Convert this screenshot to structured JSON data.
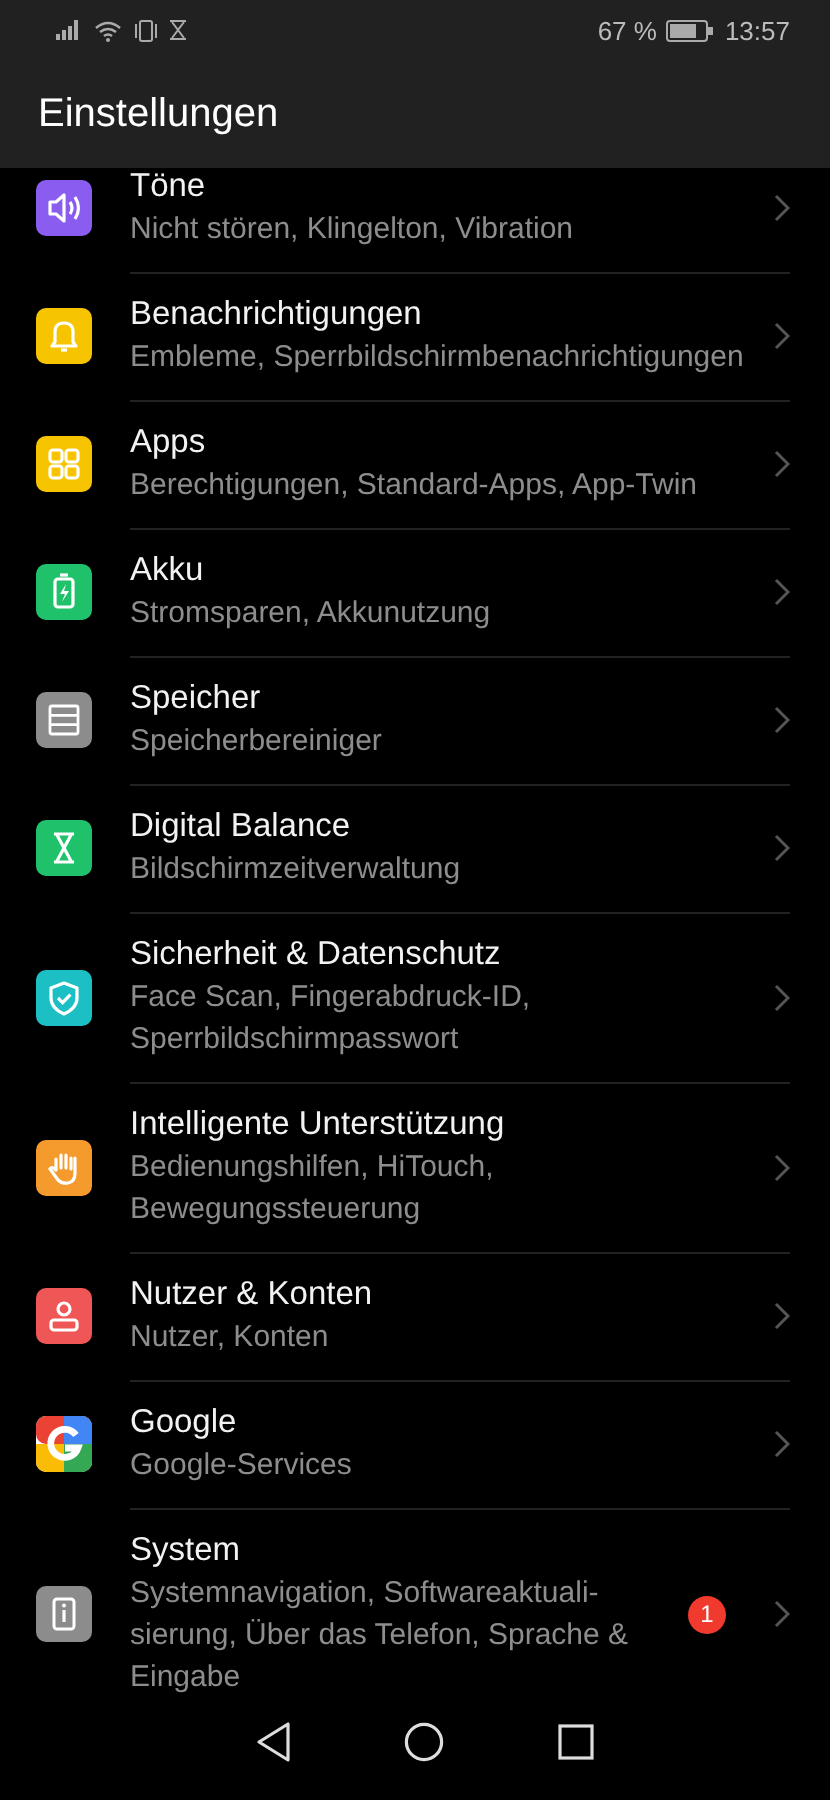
{
  "status_bar": {
    "battery": "67 %",
    "time": "13:57"
  },
  "header": {
    "title": "Einstellungen"
  },
  "items": [
    {
      "title": "Töne",
      "subtitle": "Nicht stören, Klingelton, Vibration",
      "color": "#8a5cf0"
    },
    {
      "title": "Benachrichtigungen",
      "subtitle": "Embleme, Sperrbildschirmbenachrichtigungen",
      "color": "#f6c400"
    },
    {
      "title": "Apps",
      "subtitle": "Berechtigungen, Standard-Apps, App-Twin",
      "color": "#f6c400"
    },
    {
      "title": "Akku",
      "subtitle": "Stromsparen, Akkunutzung",
      "color": "#1fc26b"
    },
    {
      "title": "Speicher",
      "subtitle": "Speicherbereiniger",
      "color": "#8c8c8c"
    },
    {
      "title": "Digital Balance",
      "subtitle": "Bildschirmzeitverwaltung",
      "color": "#1fc26b"
    },
    {
      "title": "Sicherheit & Datenschutz",
      "subtitle": "Face Scan, Fingerabdruck-ID, Sperrbildschirmpasswort",
      "color": "#1cbfc4"
    },
    {
      "title": "Intelligente Unterstützung",
      "subtitle": "Bedienungshilfen, HiTouch, Bewegungssteuerung",
      "color": "#f59a2c"
    },
    {
      "title": "Nutzer & Konten",
      "subtitle": "Nutzer, Konten",
      "color": "#ef5656"
    },
    {
      "title": "Google",
      "subtitle": "Google-Services",
      "color": "#ffffff"
    },
    {
      "title": "System",
      "subtitle": "Systemnavigation, Softwareaktuali-sierung, Über das Telefon, Sprache & Eingabe",
      "color": "#8c8c8c",
      "badge": "1"
    }
  ]
}
